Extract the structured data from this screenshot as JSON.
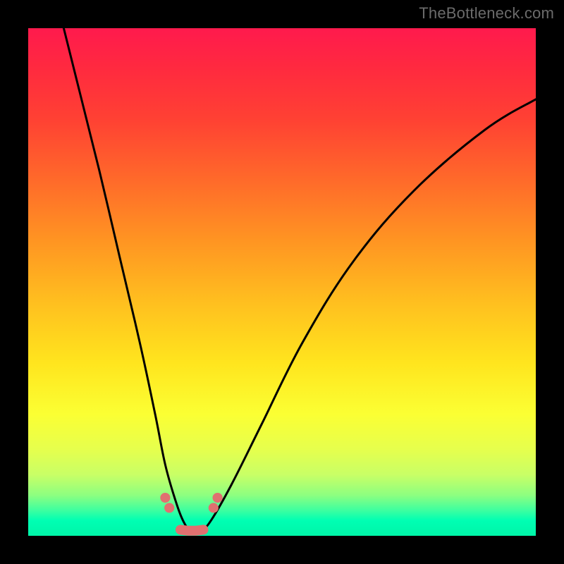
{
  "watermark": "TheBottleneck.com",
  "chart_data": {
    "type": "line",
    "title": "",
    "xlabel": "",
    "ylabel": "",
    "xlim": [
      0,
      100
    ],
    "ylim": [
      0,
      100
    ],
    "grid": false,
    "series": [
      {
        "name": "curve",
        "x": [
          7,
          10,
          14,
          18,
          22,
          25,
          27,
          29,
          30.5,
          32,
          34,
          36,
          40,
          46,
          54,
          64,
          76,
          90,
          100
        ],
        "y": [
          100,
          88,
          72,
          55,
          38,
          24,
          14,
          7,
          3,
          1,
          1,
          3,
          10,
          22,
          38,
          54,
          68,
          80,
          86
        ]
      },
      {
        "name": "bottom-markers",
        "x": [
          27,
          27.8,
          30,
          31.5,
          33,
          34.5,
          36.5,
          37.3
        ],
        "y": [
          7.5,
          5.5,
          1.2,
          1,
          1,
          1.2,
          5.5,
          7.5
        ]
      }
    ],
    "colors": {
      "curve": "#000000",
      "markers": "#e07070",
      "gradient_top": "#ff1a4d",
      "gradient_bottom": "#00f5a8"
    }
  }
}
